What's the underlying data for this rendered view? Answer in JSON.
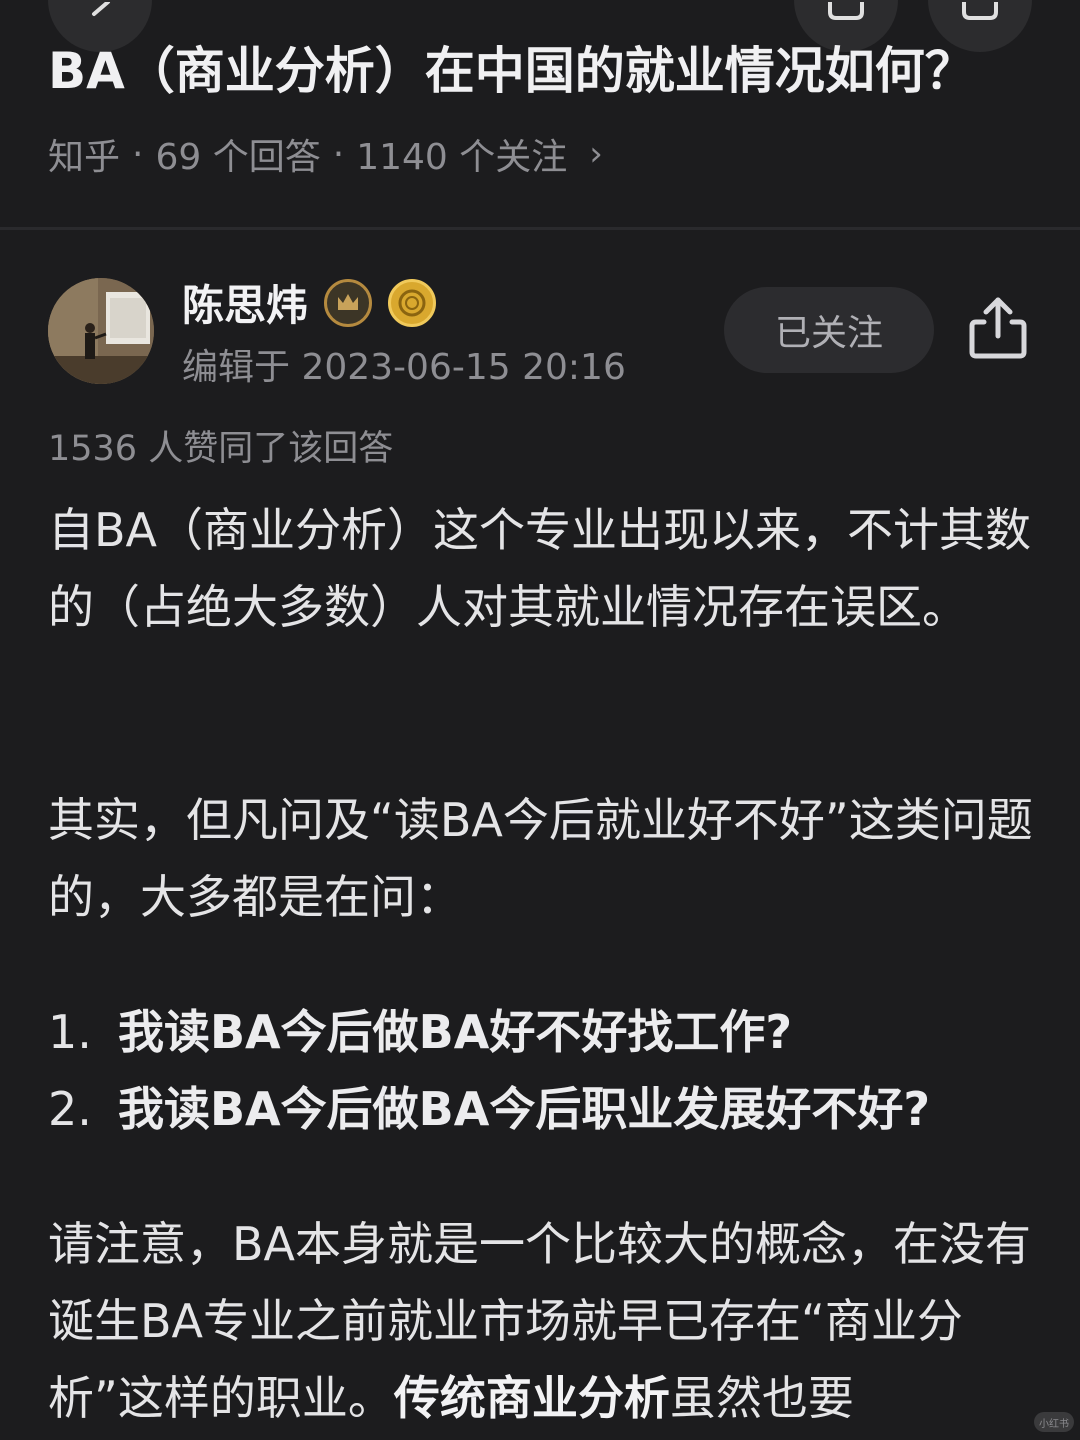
{
  "question": {
    "title": "BA（商业分析）在中国的就业情况如何？",
    "source": "知乎",
    "answers": "69 个回答",
    "followers": "1140 个关注"
  },
  "answer": {
    "author": "陈思炜",
    "edited": "编辑于 2023-06-15 20:16",
    "follow_label": "已关注",
    "likes": "1536 人赞同了该回答",
    "paragraph1": "自BA（商业分析）这个专业出现以来，不计其数的（占绝大多数）人对其就业情况存在误区。",
    "paragraph2": "其实，但凡问及“读BA今后就业好不好”这类问题的，大多都是在问：",
    "list": [
      {
        "num": "1.",
        "text": "我读BA今后做BA好不好找工作?"
      },
      {
        "num": "2.",
        "text": "我读BA今后做BA今后职业发展好不好?"
      }
    ],
    "paragraph3_a": "请注意，BA本身就是一个比较大的概念，在没有诞生BA专业之前就业市场就早已存在“商业分析”这样的职业。",
    "paragraph3_bold": "传统商业分析",
    "paragraph3_b": "虽然也要"
  },
  "watermark": "小红书",
  "colors": {
    "background": "#1c1c1e",
    "secondary_text": "#8e8e93",
    "badge_gold": "#d9a82e"
  },
  "icons": [
    "back-icon",
    "bookmark-icon",
    "share-top-icon",
    "crown-badge-icon",
    "gold-coin-badge-icon",
    "share-icon"
  ]
}
